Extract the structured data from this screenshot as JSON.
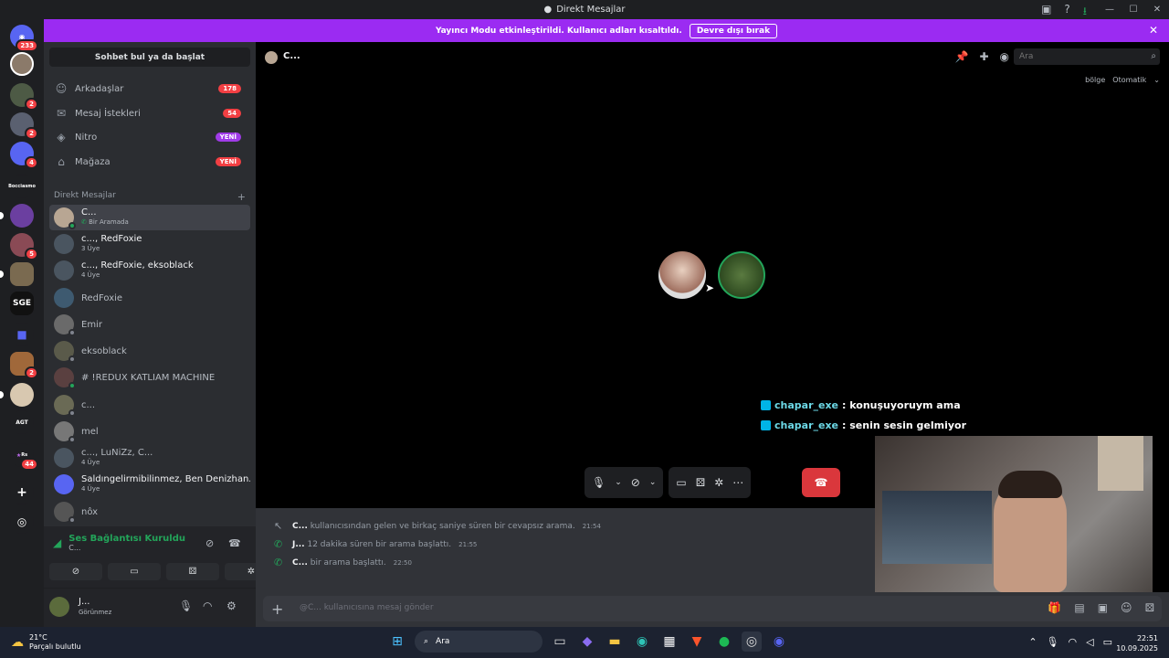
{
  "window": {
    "title": "Direkt Mesajlar"
  },
  "banner": {
    "text": "Yayıncı Modu etkinleştirildi. Kullanıcı adları kısaltıldı.",
    "button": "Devre dışı bırak"
  },
  "servers": [
    {
      "badge": "233"
    },
    {
      "badge": ""
    },
    {
      "badge": "2"
    },
    {
      "badge": "2"
    },
    {
      "badge": "4"
    },
    {
      "label": "Bocciasmo",
      "badge": ""
    },
    {
      "badge": ""
    },
    {
      "badge": "5"
    },
    {
      "badge": ""
    },
    {
      "label": "SGE",
      "badge": ""
    },
    {
      "badge": ""
    },
    {
      "badge": "2"
    },
    {
      "badge": ""
    },
    {
      "label": "AGT",
      "badge": ""
    },
    {
      "label": "Rs",
      "badge": "44"
    }
  ],
  "sidebar": {
    "find": "Sohbet bul ya da başlat",
    "nav": [
      {
        "label": "Arkadaşlar",
        "badge": "178"
      },
      {
        "label": "Mesaj İstekleri",
        "badge": "54"
      },
      {
        "label": "Nitro",
        "badge": "YENİ"
      },
      {
        "label": "Mağaza",
        "badge": "YENİ"
      }
    ],
    "dm_header": "Direkt Mesajlar",
    "dms": [
      {
        "name": "C...",
        "sub": "Bir Aramada"
      },
      {
        "name": "c..., RedFoxie",
        "sub": "3 Üye"
      },
      {
        "name": "c..., RedFoxie, eksoblack",
        "sub": "4 Üye"
      },
      {
        "name": "RedFoxie",
        "sub": ""
      },
      {
        "name": "Emir",
        "sub": ""
      },
      {
        "name": "eksoblack",
        "sub": ""
      },
      {
        "name": "# !REDUX KATLİAM MACHİNE",
        "sub": ""
      },
      {
        "name": "c...",
        "sub": ""
      },
      {
        "name": "mel",
        "sub": ""
      },
      {
        "name": "c..., LuNiZz, C...",
        "sub": "4 Üye"
      },
      {
        "name": "Saldıngelirmibilinmez, Ben Denizhan...",
        "sub": "4 Üye"
      },
      {
        "name": "nôx",
        "sub": ""
      }
    ]
  },
  "voice": {
    "status": "Ses Bağlantısı Kuruldu",
    "channel": "C..."
  },
  "user": {
    "name": "J...",
    "status": "Görünmez"
  },
  "main": {
    "header_name": "C...",
    "search_placeholder": "Ara",
    "region_label": "bölge",
    "region_value": "Otomatik",
    "chat": [
      {
        "user": "chapar_exe",
        "text": ": konuşuyoruym ama"
      },
      {
        "user": "chapar_exe",
        "text": ": senin sesin gelmiyor"
      }
    ],
    "log": [
      {
        "name": "C...",
        "text": "kullanıcısından gelen ve birkaç saniye süren bir cevapsız arama.",
        "time": "21:54"
      },
      {
        "name": "J...",
        "text": "12 dakika süren bir arama başlattı.",
        "time": "21:55"
      },
      {
        "name": "C...",
        "text": "bir arama başlattı.",
        "time": "22:50"
      }
    ],
    "compose_placeholder": "@C... kullanıcısına mesaj gönder"
  },
  "taskbar": {
    "temp": "21°C",
    "weather": "Parçalı bulutlu",
    "search": "Ara",
    "time": "22:51",
    "date": "10.09.2025"
  },
  "icons": {
    "accent": "#9b2bf2",
    "danger": "#da373c",
    "online": "#23a55a"
  }
}
